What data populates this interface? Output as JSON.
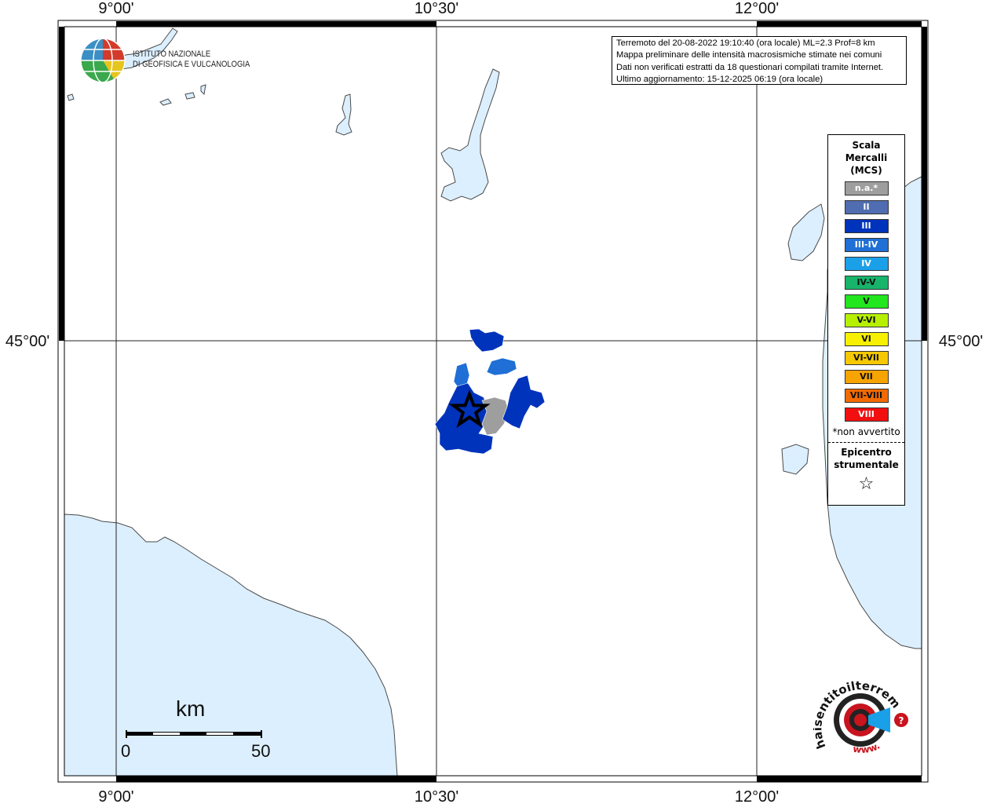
{
  "map": {
    "lon_labels": [
      "9°00'",
      "10°30'",
      "12°00'"
    ],
    "lat_labels": [
      "45°00'"
    ],
    "colors": {
      "sea": "#dcefff",
      "land": "#ffffff",
      "coast": "#4a4a4a",
      "grid": "#222222"
    }
  },
  "info": {
    "line1": "Terremoto del 20-08-2022 19:10:40 (ora locale) ML=2.3 Prof=8 km",
    "line2": "Mappa preliminare delle intensità macrosismiche stimate nei comuni",
    "line3": "Dati non verificati estratti da 18 questionari compilati tramite Internet.",
    "line4": "Ultimo aggiornamento: 15-12-2025 06:19 (ora locale)"
  },
  "logo": {
    "line1": "ISTITUTO NAZIONALE",
    "line2": "DI GEOFISICA E VULCANOLOGIA"
  },
  "legend": {
    "title1": "Scala",
    "title2": "Mercalli",
    "title3": "(MCS)",
    "items": [
      {
        "label": "n.a.*",
        "color": "#9e9e9e"
      },
      {
        "label": "II",
        "color": "#4f6db0"
      },
      {
        "label": "III",
        "color": "#0033bb"
      },
      {
        "label": "III-IV",
        "color": "#1f6fd6"
      },
      {
        "label": "IV",
        "color": "#1aa0e8"
      },
      {
        "label": "IV-V",
        "color": "#17b46a"
      },
      {
        "label": "V",
        "color": "#22e61e"
      },
      {
        "label": "V-VI",
        "color": "#b6f000"
      },
      {
        "label": "VI",
        "color": "#f7f000"
      },
      {
        "label": "VI-VII",
        "color": "#f5c800"
      },
      {
        "label": "VII",
        "color": "#f7a300"
      },
      {
        "label": "VII-VIII",
        "color": "#f26a00"
      },
      {
        "label": "VIII",
        "color": "#f20f0f"
      }
    ],
    "note": "*non avvertito",
    "epi1": "Epicentro",
    "epi2": "strumentale",
    "star": "☆"
  },
  "scale": {
    "title": "km",
    "left": "0",
    "right": "50"
  },
  "badge": {
    "text": "haisentitoilterremoto.it",
    "url": "www.",
    "question": "?"
  }
}
